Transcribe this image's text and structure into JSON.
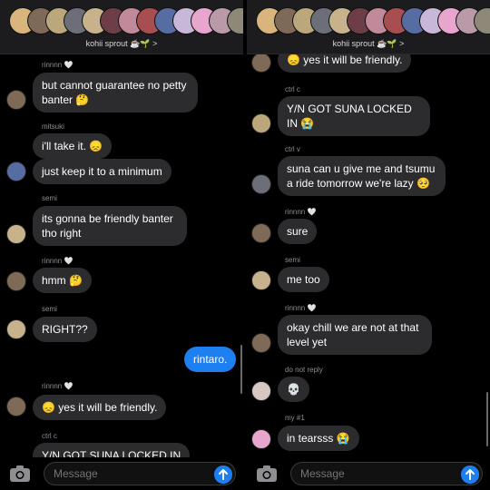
{
  "group": {
    "name": "kohii sprout ☕🌱 >"
  },
  "composer": {
    "placeholder": "Message"
  },
  "left": {
    "messages": [
      {
        "sender": "rinnnn 🤍",
        "text": "but cannot guarantee no petty banter 🤔"
      },
      {
        "sender": "mitsuki",
        "text": "i'll take it. 😞"
      },
      {
        "sender": "",
        "text": "just keep it to a minimum"
      },
      {
        "sender": "semi",
        "text": "its gonna be friendly banter tho right"
      },
      {
        "sender": "rinnnn 🤍",
        "text": "hmm 🤔"
      },
      {
        "sender": "semi",
        "text": "RIGHT??"
      },
      {
        "sender": "",
        "text": "rintaro."
      },
      {
        "sender": "rinnnn 🤍",
        "text": "😞 yes it will be friendly."
      },
      {
        "sender": "ctrl c",
        "text": "Y/N GOT SUNA LOCKED IN"
      }
    ]
  },
  "right": {
    "messages": [
      {
        "sender": "",
        "text": "😞 yes it will be friendly."
      },
      {
        "sender": "ctrl c",
        "text": "Y/N GOT SUNA LOCKED IN 😭"
      },
      {
        "sender": "ctrl v",
        "text": "suna can u give me and tsumu a ride tomorrow we're lazy 🥺"
      },
      {
        "sender": "rinnnn 🤍",
        "text": "sure"
      },
      {
        "sender": "semi",
        "text": "me too"
      },
      {
        "sender": "rinnnn 🤍",
        "text": "okay chill we are not at that level yet"
      },
      {
        "sender": "do not reply",
        "text": "💀"
      },
      {
        "sender": "my #1",
        "text": "in tearsss 😭"
      }
    ]
  },
  "colors": {
    "avatar_palette": [
      "#d9b47c",
      "#7f6a57",
      "#bca67c",
      "#6c6f77",
      "#c7b28b",
      "#6d3d48",
      "#c08a9b",
      "#a84d50",
      "#566ca3",
      "#c8b7d8",
      "#e8a6cf",
      "#bb9aa8",
      "#8d8878"
    ],
    "bubble_in": "#2c2c2e",
    "bubble_out": "#1e80f0"
  }
}
